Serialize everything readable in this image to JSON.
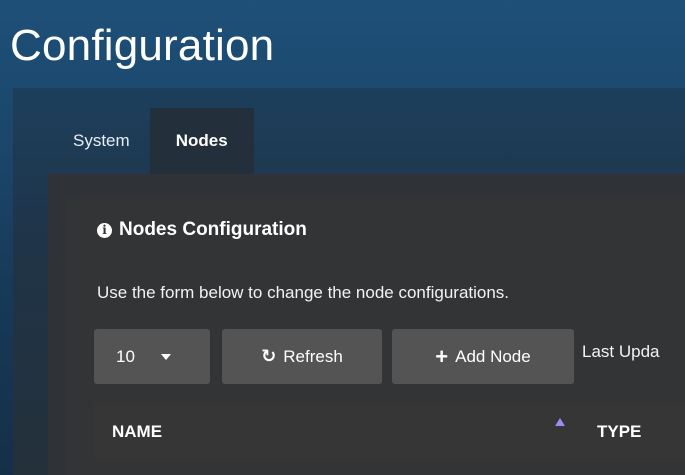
{
  "page": {
    "title": "Configuration"
  },
  "tabs": [
    {
      "label": "System",
      "active": false
    },
    {
      "label": "Nodes",
      "active": true
    }
  ],
  "section": {
    "icon": "info-icon",
    "heading": "Nodes Configuration",
    "description": "Use the form below to change the node configurations."
  },
  "toolbar": {
    "page_size": "10",
    "page_size_icon": "chevron-down-icon",
    "refresh_label": "Refresh",
    "refresh_icon": "refresh-icon",
    "add_label": "Add Node",
    "add_icon": "plus-icon",
    "last_updated_label": "Last Upda"
  },
  "table": {
    "columns": [
      {
        "label": "NAME",
        "sorted": "ascending"
      },
      {
        "label": "TYPE"
      }
    ]
  },
  "colors": {
    "background": "#1c4a70",
    "panel": "#333435",
    "button": "#545454",
    "sort_indicator": "#9b8cf0"
  }
}
